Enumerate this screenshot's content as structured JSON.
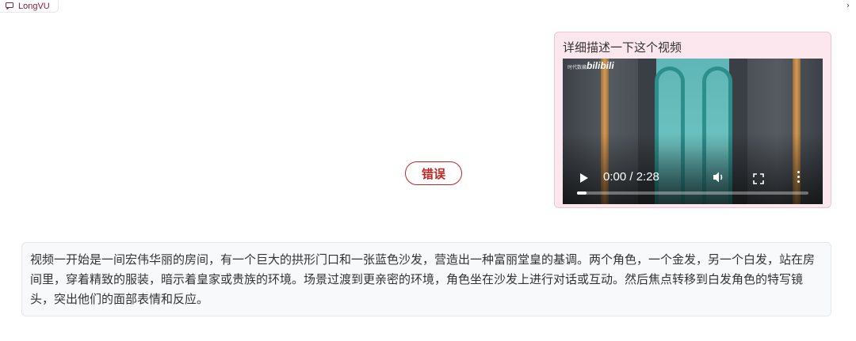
{
  "header": {
    "app_name": "LongVU"
  },
  "chat": {
    "user_message": "详细描述一下这个视频",
    "video": {
      "time_display": "0:00 / 2:28",
      "progress": 0,
      "watermark": "时代数藏",
      "brand": "bilibili"
    },
    "error_label": "错误",
    "answer_text": "视频一开始是一间宏伟华丽的房间，有一个巨大的拱形门口和一张蓝色沙发，营造出一种富丽堂皇的基调。两个角色，一个金发，另一个白发，站在房间里，穿着精致的服装，暗示着皇家或贵族的环境。场景过渡到更亲密的环境，角色坐在沙发上进行对话或互动。然后焦点转移到白发角色的特写镜头，突出他们的面部表情和反应。"
  },
  "icons": {
    "tab_icon": "chat-icon",
    "close_icon": "close-icon",
    "play_icon": "play-icon",
    "volume_icon": "volume-icon",
    "fullscreen_icon": "fullscreen-icon",
    "more_icon": "more-vertical-icon"
  },
  "colors": {
    "accent": "#8b1c3a",
    "error": "#c02626",
    "user_bubble_bg": "#fce7ef"
  }
}
